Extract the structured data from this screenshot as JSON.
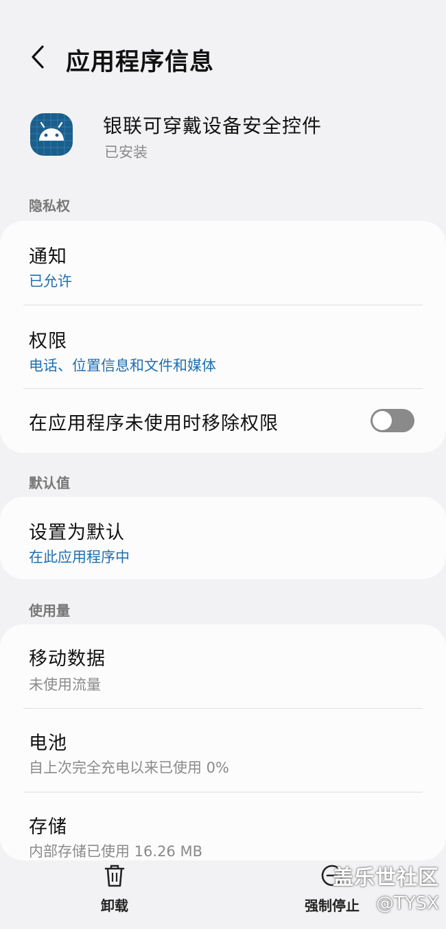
{
  "header": {
    "title": "应用程序信息",
    "back_icon": "chevron-left-icon"
  },
  "app": {
    "name": "银联可穿戴设备安全控件",
    "status": "已安装",
    "icon": "android-app-icon",
    "icon_color": "#1b5e8a"
  },
  "privacy": {
    "label": "隐私权",
    "notifications": {
      "title": "通知",
      "value": "已允许"
    },
    "permissions": {
      "title": "权限",
      "value": "电话、位置信息和文件和媒体"
    },
    "remove_unused": {
      "title": "在应用程序未使用时移除权限",
      "enabled": false
    }
  },
  "defaults": {
    "label": "默认值",
    "set_default": {
      "title": "设置为默认",
      "value": "在此应用程序中"
    }
  },
  "usage": {
    "label": "使用量",
    "mobile_data": {
      "title": "移动数据",
      "value": "未使用流量"
    },
    "battery": {
      "title": "电池",
      "value": "自上次完全充电以来已使用 0%"
    },
    "storage": {
      "title": "存储",
      "value": "内部存储已使用 16.26 MB"
    }
  },
  "bottom_bar": {
    "uninstall": {
      "label": "卸载",
      "icon": "trash-icon"
    },
    "force_stop": {
      "label": "强制停止",
      "icon": "stop-icon"
    }
  },
  "watermark": {
    "line1": "盖乐世社区",
    "line2": "@TYSX"
  },
  "colors": {
    "background": "#f2f2f4",
    "card": "#fcfcfc",
    "accent_blue": "#1f6fb0",
    "secondary_text": "#8a8a8a"
  }
}
